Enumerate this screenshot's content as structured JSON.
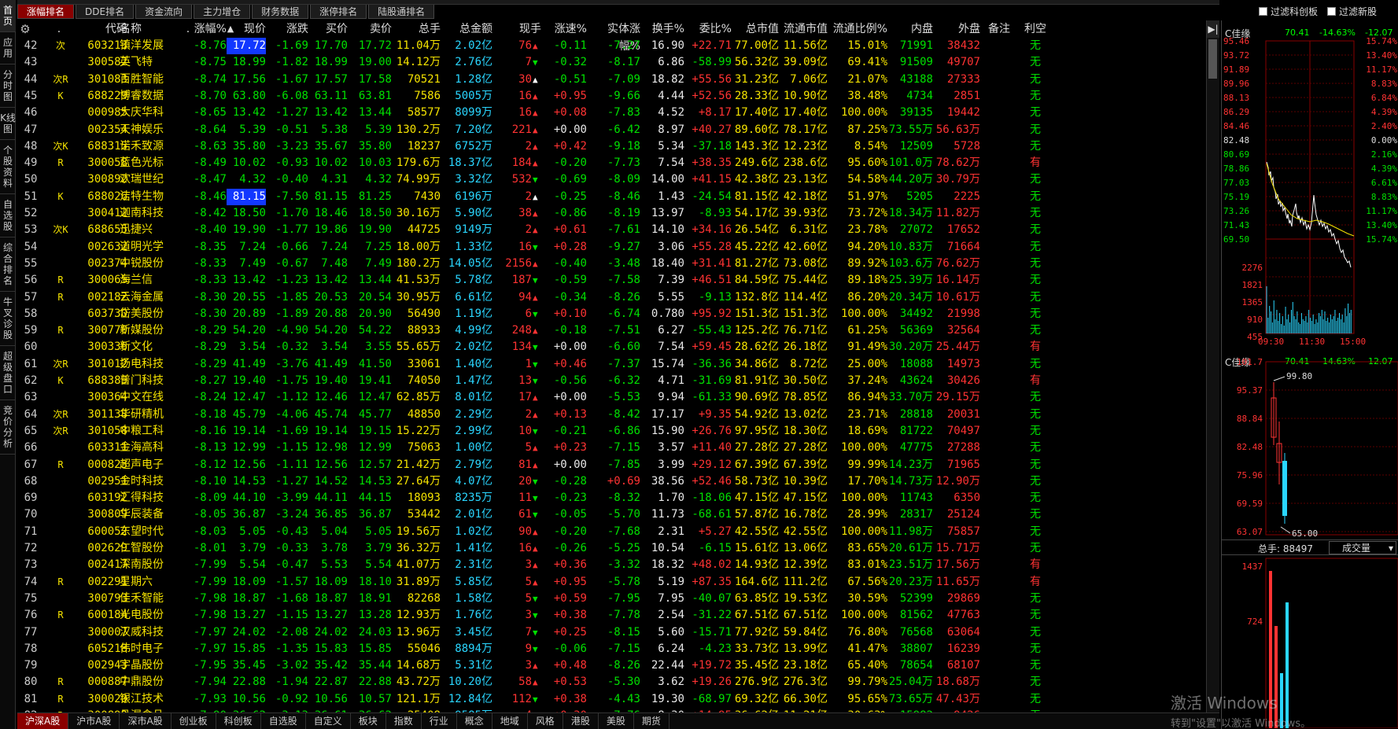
{
  "leftnav": [
    "首页",
    "应用",
    "分时图",
    "K线图",
    "个股资料",
    "自选股",
    "综合排名",
    "牛叉诊股",
    "超级盘口",
    "竞价分析"
  ],
  "toptabs": [
    {
      "label": "涨幅排名",
      "active": true
    },
    {
      "label": "DDE排名",
      "active": false
    },
    {
      "label": "资金流向",
      "active": false
    },
    {
      "label": "主力增仓",
      "active": false
    },
    {
      "label": "财务数据",
      "active": false
    },
    {
      "label": "涨停排名",
      "active": false
    },
    {
      "label": "陆股通排名",
      "active": false
    }
  ],
  "filters": [
    "过滤科创板",
    "过滤新股"
  ],
  "columns": [
    "",
    "代码",
    "名称",
    "",
    "涨幅%",
    "现价",
    "涨跌",
    "买价",
    "卖价",
    "总手",
    "总金额",
    "现手",
    "涨速%",
    "实体涨幅%",
    "换手%",
    "委比%",
    "总市值",
    "流通市值",
    "流通比例%",
    "内盘",
    "外盘",
    "备注",
    "利空"
  ],
  "rows": [
    [
      "42",
      "次",
      "603213",
      "镇洋发展",
      "-8.76",
      "17.72",
      "-1.69",
      "17.70",
      "17.72",
      "11.04万",
      "2.02亿",
      "76",
      "u",
      "-0.11",
      "-7.27",
      "16.90",
      "+22.71",
      "77.00亿",
      "11.56亿",
      "15.01%",
      "71991",
      "38432",
      "",
      "无",
      1
    ],
    [
      "43",
      "",
      "300582",
      "英飞特",
      "-8.75",
      "18.99",
      "-1.82",
      "18.99",
      "19.00",
      "14.12万",
      "2.76亿",
      "7",
      "d",
      "-0.32",
      "-8.17",
      "6.86",
      "-58.99",
      "56.32亿",
      "39.09亿",
      "69.41%",
      "91509",
      "49707",
      "",
      "无",
      0
    ],
    [
      "44",
      "次R",
      "301083",
      "百胜智能",
      "-8.74",
      "17.56",
      "-1.67",
      "17.57",
      "17.58",
      "70521",
      "1.28亿",
      "30",
      "w",
      "-0.51",
      "-7.09",
      "18.82",
      "+55.56",
      "31.23亿",
      "7.06亿",
      "21.07%",
      "43188",
      "27333",
      "",
      "无",
      0
    ],
    [
      "45",
      "K",
      "688229",
      "博睿数据",
      "-8.70",
      "63.80",
      "-6.08",
      "63.11",
      "63.81",
      "7586",
      "5005万",
      "16",
      "u",
      "+0.95",
      "-9.66",
      "4.44",
      "+52.56",
      "28.33亿",
      "10.90亿",
      "38.48%",
      "4734",
      "2851",
      "",
      "无",
      0
    ],
    [
      "46",
      "",
      "000985",
      "大庆华科",
      "-8.65",
      "13.42",
      "-1.27",
      "13.42",
      "13.44",
      "58577",
      "8099万",
      "16",
      "u",
      "+0.08",
      "-7.83",
      "4.52",
      "+8.17",
      "17.40亿",
      "17.40亿",
      "100.00%",
      "39135",
      "19442",
      "",
      "无",
      0
    ],
    [
      "47",
      "",
      "002354",
      "天神娱乐",
      "-8.64",
      "5.39",
      "-0.51",
      "5.38",
      "5.39",
      "130.2万",
      "7.20亿",
      "221",
      "u",
      "+0.00",
      "-6.42",
      "8.97",
      "+40.27",
      "89.60亿",
      "78.17亿",
      "87.25%",
      "73.55万",
      "56.63万",
      "",
      "无",
      0
    ],
    [
      "48",
      "次K",
      "688315",
      "诺禾致源",
      "-8.63",
      "35.80",
      "-3.23",
      "35.67",
      "35.80",
      "18237",
      "6752万",
      "2",
      "u",
      "+0.42",
      "-9.18",
      "5.34",
      "-37.18",
      "143.3亿",
      "12.23亿",
      "8.54%",
      "12509",
      "5728",
      "",
      "无",
      0
    ],
    [
      "49",
      "R",
      "300058",
      "蓝色光标",
      "-8.49",
      "10.02",
      "-0.93",
      "10.02",
      "10.03",
      "179.6万",
      "18.37亿",
      "184",
      "u",
      "-0.20",
      "-7.73",
      "7.54",
      "+38.35",
      "249.6亿",
      "238.6亿",
      "95.60%",
      "101.0万",
      "78.62万",
      "",
      "有",
      0
    ],
    [
      "50",
      "",
      "300892",
      "欢瑞世纪",
      "-8.47",
      "4.32",
      "-0.40",
      "4.31",
      "4.32",
      "74.99万",
      "3.32亿",
      "532",
      "d",
      "-0.69",
      "-8.09",
      "14.00",
      "+41.15",
      "42.38亿",
      "23.13亿",
      "54.58%",
      "44.20万",
      "30.79万",
      "",
      "无",
      0
    ],
    [
      "51",
      "K",
      "688026",
      "洁特生物",
      "-8.46",
      "81.15",
      "-7.50",
      "81.15",
      "81.25",
      "7430",
      "6196万",
      "2",
      "w",
      "-0.25",
      "-8.46",
      "1.43",
      "-24.54",
      "81.15亿",
      "42.18亿",
      "51.97%",
      "5205",
      "2225",
      "",
      "无",
      1
    ],
    [
      "52",
      "",
      "300412",
      "迦南科技",
      "-8.42",
      "18.50",
      "-1.70",
      "18.46",
      "18.50",
      "30.16万",
      "5.90亿",
      "38",
      "u",
      "-0.86",
      "-8.19",
      "13.97",
      "-8.93",
      "54.17亿",
      "39.93亿",
      "73.72%",
      "18.34万",
      "11.82万",
      "",
      "无",
      0
    ],
    [
      "53",
      "次K",
      "688655",
      "迅捷兴",
      "-8.40",
      "19.90",
      "-1.77",
      "19.86",
      "19.90",
      "44725",
      "9149万",
      "2",
      "u",
      "+0.61",
      "-7.61",
      "14.10",
      "+34.16",
      "26.54亿",
      "6.31亿",
      "23.78%",
      "27072",
      "17652",
      "",
      "无",
      0
    ],
    [
      "54",
      "",
      "002632",
      "道明光学",
      "-8.35",
      "7.24",
      "-0.66",
      "7.24",
      "7.25",
      "18.00万",
      "1.33亿",
      "16",
      "d",
      "+0.28",
      "-9.27",
      "3.06",
      "+55.28",
      "45.22亿",
      "42.60亿",
      "94.20%",
      "10.83万",
      "71664",
      "",
      "无",
      0
    ],
    [
      "55",
      "",
      "002374",
      "中锐股份",
      "-8.33",
      "7.49",
      "-0.67",
      "7.48",
      "7.49",
      "180.2万",
      "14.05亿",
      "2156",
      "u",
      "-0.40",
      "-3.48",
      "18.40",
      "+31.41",
      "81.27亿",
      "73.08亿",
      "89.92%",
      "103.6万",
      "76.62万",
      "",
      "无",
      0
    ],
    [
      "56",
      "R",
      "300065",
      "海兰信",
      "-8.33",
      "13.42",
      "-1.23",
      "13.42",
      "13.44",
      "41.53万",
      "5.78亿",
      "187",
      "d",
      "-0.59",
      "-7.58",
      "7.39",
      "+46.51",
      "84.59亿",
      "75.44亿",
      "89.18%",
      "25.39万",
      "16.14万",
      "",
      "无",
      0
    ],
    [
      "57",
      "R",
      "002182",
      "云海金属",
      "-8.30",
      "20.55",
      "-1.85",
      "20.53",
      "20.54",
      "30.95万",
      "6.61亿",
      "94",
      "u",
      "-0.34",
      "-8.26",
      "5.55",
      "-9.13",
      "132.8亿",
      "114.4亿",
      "86.20%",
      "20.34万",
      "10.61万",
      "",
      "无",
      0
    ],
    [
      "58",
      "",
      "603730",
      "岱美股份",
      "-8.30",
      "20.89",
      "-1.89",
      "20.88",
      "20.90",
      "56490",
      "1.19亿",
      "6",
      "d",
      "+0.10",
      "-6.74",
      "0.780",
      "+95.92",
      "151.3亿",
      "151.3亿",
      "100.00%",
      "34492",
      "21998",
      "",
      "无",
      0
    ],
    [
      "59",
      "R",
      "300770",
      "新媒股份",
      "-8.29",
      "54.20",
      "-4.90",
      "54.20",
      "54.22",
      "88933",
      "4.99亿",
      "248",
      "u",
      "-0.18",
      "-7.51",
      "6.27",
      "-55.43",
      "125.2亿",
      "76.71亿",
      "61.25%",
      "56369",
      "32564",
      "",
      "无",
      0
    ],
    [
      "60",
      "",
      "300336",
      "新文化",
      "-8.29",
      "3.54",
      "-0.32",
      "3.54",
      "3.55",
      "55.65万",
      "2.02亿",
      "134",
      "d",
      "+0.00",
      "-6.60",
      "7.54",
      "+59.45",
      "28.62亿",
      "26.18亿",
      "91.49%",
      "30.20万",
      "25.44万",
      "",
      "有",
      0
    ],
    [
      "61",
      "次R",
      "301012",
      "扬电科技",
      "-8.29",
      "41.49",
      "-3.76",
      "41.49",
      "41.50",
      "33061",
      "1.40亿",
      "1",
      "d",
      "+0.46",
      "-7.37",
      "15.74",
      "-36.36",
      "34.86亿",
      "8.72亿",
      "25.00%",
      "18088",
      "14973",
      "",
      "无",
      0
    ],
    [
      "62",
      "K",
      "688389",
      "普门科技",
      "-8.27",
      "19.40",
      "-1.75",
      "19.40",
      "19.41",
      "74050",
      "1.47亿",
      "13",
      "d",
      "-0.56",
      "-6.32",
      "4.71",
      "-31.69",
      "81.91亿",
      "30.50亿",
      "37.24%",
      "43624",
      "30426",
      "",
      "有",
      0
    ],
    [
      "63",
      "",
      "300364",
      "中文在线",
      "-8.24",
      "12.47",
      "-1.12",
      "12.46",
      "12.47",
      "62.85万",
      "8.01亿",
      "17",
      "u",
      "+0.00",
      "-5.53",
      "9.94",
      "-61.33",
      "90.69亿",
      "78.85亿",
      "86.94%",
      "33.70万",
      "29.15万",
      "",
      "无",
      0
    ],
    [
      "64",
      "次R",
      "301138",
      "华研精机",
      "-8.18",
      "45.79",
      "-4.06",
      "45.74",
      "45.77",
      "48850",
      "2.29亿",
      "2",
      "u",
      "+0.13",
      "-8.42",
      "17.17",
      "+9.35",
      "54.92亿",
      "13.02亿",
      "23.71%",
      "28818",
      "20031",
      "",
      "无",
      0
    ],
    [
      "65",
      "次R",
      "301058",
      "中粮工科",
      "-8.16",
      "19.14",
      "-1.69",
      "19.14",
      "19.15",
      "15.22万",
      "2.99亿",
      "10",
      "d",
      "-0.21",
      "-6.86",
      "15.90",
      "+26.76",
      "97.95亿",
      "18.30亿",
      "18.69%",
      "81722",
      "70497",
      "",
      "无",
      0
    ],
    [
      "66",
      "",
      "603311",
      "金海高科",
      "-8.13",
      "12.99",
      "-1.15",
      "12.98",
      "12.99",
      "75063",
      "1.00亿",
      "5",
      "u",
      "+0.23",
      "-7.15",
      "3.57",
      "+11.40",
      "27.28亿",
      "27.28亿",
      "100.00%",
      "47775",
      "27288",
      "",
      "无",
      0
    ],
    [
      "67",
      "R",
      "000823",
      "超声电子",
      "-8.12",
      "12.56",
      "-1.11",
      "12.56",
      "12.57",
      "21.42万",
      "2.79亿",
      "81",
      "u",
      "+0.00",
      "-7.85",
      "3.99",
      "+29.12",
      "67.39亿",
      "67.39亿",
      "99.99%",
      "14.23万",
      "71965",
      "",
      "无",
      0
    ],
    [
      "68",
      "",
      "002951",
      "金时科技",
      "-8.10",
      "14.53",
      "-1.27",
      "14.52",
      "14.53",
      "27.64万",
      "4.07亿",
      "20",
      "d",
      "-0.28",
      "+0.69",
      "38.56",
      "+52.46",
      "58.73亿",
      "10.39亿",
      "17.70%",
      "14.73万",
      "12.90万",
      "",
      "无",
      0
    ],
    [
      "69",
      "",
      "603192",
      "汇得科技",
      "-8.09",
      "44.10",
      "-3.99",
      "44.11",
      "44.15",
      "18093",
      "8235万",
      "11",
      "d",
      "-0.23",
      "-8.32",
      "1.70",
      "-18.06",
      "47.15亿",
      "47.15亿",
      "100.00%",
      "11743",
      "6350",
      "",
      "无",
      0
    ],
    [
      "70",
      "",
      "300809",
      "华辰装备",
      "-8.05",
      "36.87",
      "-3.24",
      "36.85",
      "36.87",
      "53442",
      "2.01亿",
      "61",
      "d",
      "-0.05",
      "-5.70",
      "11.73",
      "-68.61",
      "57.87亿",
      "16.78亿",
      "28.99%",
      "28317",
      "25124",
      "",
      "无",
      0
    ],
    [
      "71",
      "",
      "600052",
      "东望时代",
      "-8.03",
      "5.05",
      "-0.43",
      "5.04",
      "5.05",
      "19.56万",
      "1.02亿",
      "90",
      "u",
      "-0.20",
      "-7.68",
      "2.31",
      "+5.27",
      "42.55亿",
      "42.55亿",
      "100.00%",
      "11.98万",
      "75857",
      "",
      "无",
      0
    ],
    [
      "72",
      "",
      "002629",
      "仁智股份",
      "-8.01",
      "3.79",
      "-0.33",
      "3.78",
      "3.79",
      "36.32万",
      "1.41亿",
      "16",
      "u",
      "-0.26",
      "-5.25",
      "10.54",
      "-6.15",
      "15.61亿",
      "13.06亿",
      "83.65%",
      "20.61万",
      "15.71万",
      "",
      "无",
      0
    ],
    [
      "73",
      "",
      "002417",
      "深南股份",
      "-7.99",
      "5.54",
      "-0.47",
      "5.53",
      "5.54",
      "41.07万",
      "2.31亿",
      "3",
      "u",
      "+0.36",
      "-3.32",
      "18.32",
      "+48.02",
      "14.93亿",
      "12.39亿",
      "83.01%",
      "23.51万",
      "17.56万",
      "",
      "有",
      0
    ],
    [
      "74",
      "R",
      "002291",
      "星期六",
      "-7.99",
      "18.09",
      "-1.57",
      "18.09",
      "18.10",
      "31.89万",
      "5.85亿",
      "5",
      "u",
      "+0.95",
      "-5.78",
      "5.19",
      "+87.35",
      "164.6亿",
      "111.2亿",
      "67.56%",
      "20.23万",
      "11.65万",
      "",
      "有",
      0
    ],
    [
      "75",
      "",
      "300793",
      "佳禾智能",
      "-7.98",
      "18.87",
      "-1.68",
      "18.87",
      "18.91",
      "82268",
      "1.58亿",
      "5",
      "d",
      "+0.59",
      "-7.95",
      "7.95",
      "-40.07",
      "63.85亿",
      "19.53亿",
      "30.59%",
      "52399",
      "29869",
      "",
      "无",
      0
    ],
    [
      "76",
      "R",
      "600184",
      "光电股份",
      "-7.98",
      "13.27",
      "-1.15",
      "13.27",
      "13.28",
      "12.93万",
      "1.76亿",
      "3",
      "d",
      "+0.38",
      "-7.78",
      "2.54",
      "-31.22",
      "67.51亿",
      "67.51亿",
      "100.00%",
      "81562",
      "47763",
      "",
      "无",
      0
    ],
    [
      "77",
      "",
      "300007",
      "汉威科技",
      "-7.97",
      "24.02",
      "-2.08",
      "24.02",
      "24.03",
      "13.96万",
      "3.45亿",
      "7",
      "d",
      "+0.25",
      "-8.15",
      "5.60",
      "-15.71",
      "77.92亿",
      "59.84亿",
      "76.80%",
      "76568",
      "63064",
      "",
      "无",
      0
    ],
    [
      "78",
      "",
      "605218",
      "伟时电子",
      "-7.97",
      "15.85",
      "-1.35",
      "15.83",
      "15.85",
      "55046",
      "8894万",
      "9",
      "d",
      "-0.06",
      "-7.15",
      "6.24",
      "-4.23",
      "33.73亿",
      "13.99亿",
      "41.47%",
      "38807",
      "16239",
      "",
      "无",
      0
    ],
    [
      "79",
      "",
      "002943",
      "宇晶股份",
      "-7.95",
      "35.45",
      "-3.02",
      "35.42",
      "35.44",
      "14.68万",
      "5.31亿",
      "3",
      "u",
      "+0.48",
      "-8.26",
      "22.44",
      "+19.72",
      "35.45亿",
      "23.18亿",
      "65.40%",
      "78654",
      "68107",
      "",
      "无",
      0
    ],
    [
      "80",
      "R",
      "000887",
      "中鼎股份",
      "-7.94",
      "22.88",
      "-1.94",
      "22.87",
      "22.88",
      "43.72万",
      "10.20亿",
      "58",
      "u",
      "+0.53",
      "-5.30",
      "3.62",
      "+19.26",
      "276.9亿",
      "276.3亿",
      "99.79%",
      "25.04万",
      "18.68万",
      "",
      "无",
      0
    ],
    [
      "81",
      "R",
      "300020",
      "银江技术",
      "-7.93",
      "10.56",
      "-0.92",
      "10.56",
      "10.57",
      "121.1万",
      "12.84亿",
      "112",
      "d",
      "+0.38",
      "-4.43",
      "19.30",
      "-68.97",
      "69.32亿",
      "66.30亿",
      "95.65%",
      "73.65万",
      "47.43万",
      "",
      "无",
      0
    ],
    [
      "82",
      "R",
      "300892",
      "品渥食品",
      "-7.90",
      "36.62",
      "-3.13",
      "36.61",
      "36.62",
      "25408",
      "9585万",
      "4",
      "u",
      "+0.30",
      "-7.76",
      "8.30",
      "+14.95",
      "36.62亿",
      "11.21亿",
      "30.63%",
      "15982",
      "9426",
      "",
      "无",
      0
    ]
  ],
  "panel": {
    "title1": "C佳缘",
    "title1_vals": [
      "70.41",
      "-14.63%",
      "-12.07"
    ],
    "price_labels": [
      "95.46",
      "93.72",
      "91.89",
      "89.96",
      "88.13",
      "86.29",
      "84.46",
      "82.48",
      "80.69",
      "78.86",
      "77.03",
      "75.19",
      "73.26",
      "71.43",
      "69.50"
    ],
    "pct_labels": [
      "15.74%",
      "13.40%",
      "11.17%",
      "8.83%",
      "6.84%",
      "4.39%",
      "2.40%",
      "0.00%",
      "2.16%",
      "4.39%",
      "6.61%",
      "8.83%",
      "11.17%",
      "13.40%",
      "15.74%"
    ],
    "vol_labels": [
      "2276",
      "1821",
      "1365",
      "910",
      "455"
    ],
    "time_labels": [
      "09:30",
      "11:30",
      "15:00"
    ],
    "title2": "C佳缘",
    "title2_vals": [
      "70.41",
      "-14.63%",
      "-12.07"
    ],
    "k_labels": [
      "101.7",
      "95.37",
      "88.84",
      "82.48",
      "75.96",
      "69.59",
      "63.07"
    ],
    "k_high": "99.80",
    "k_low": "65.00",
    "vol2_title": "总手: 88497",
    "vol2_select": "成交量",
    "vol2_labels": [
      "1437",
      "724"
    ]
  },
  "bottomtabs": [
    "沪深A股",
    "沪市A股",
    "深市A股",
    "创业板",
    "科创板",
    "自选股",
    "自定义",
    "板块",
    "指数",
    "行业",
    "概念",
    "地域",
    "风格",
    "港股",
    "美股",
    "期货"
  ],
  "watermark": {
    "line1": "激活 Windows",
    "line2": "转到\"设置\"以激活 Windows。"
  }
}
